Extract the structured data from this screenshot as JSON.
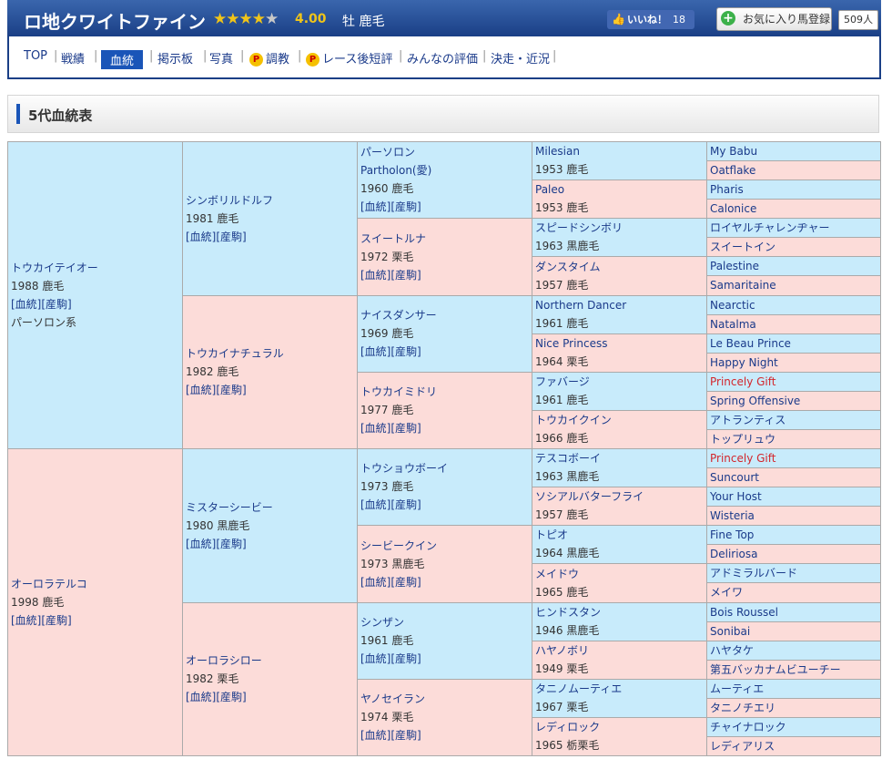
{
  "header": {
    "horse_name": "ロ地クワイトファイン",
    "rating_stars_filled": 4,
    "rating_stars_total": 5,
    "rating_value": "4.00",
    "sex_color": "牡 鹿毛",
    "like_label": "いいね！",
    "like_count": "18",
    "fav_label": "お気に入り馬登録",
    "fav_count": "509人"
  },
  "nav": {
    "items": [
      "TOP",
      "戦績",
      "血統",
      "掲示板",
      "写真",
      "調教",
      "レース後短評",
      "みんなの評価",
      "決走・近況"
    ],
    "active": "血統"
  },
  "section": {
    "title": "5代血統表"
  },
  "links": {
    "pedigree": "[血統]",
    "offspring": "[産駒]"
  },
  "pedigree": {
    "g1": [
      {
        "name": "トウカイテイオー",
        "info": "1988 鹿毛",
        "extra": "パーソロン系"
      },
      {
        "name": "オーロラテルコ",
        "info": "1998 鹿毛"
      }
    ],
    "g2": [
      {
        "name": "シンボリルドルフ",
        "info": "1981 鹿毛"
      },
      {
        "name": "トウカイナチュラル",
        "info": "1982 鹿毛"
      },
      {
        "name": "ミスターシービー",
        "info": "1980 黒鹿毛"
      },
      {
        "name": "オーロラシロー",
        "info": "1982 栗毛"
      }
    ],
    "g3": [
      {
        "name": "パーソロン",
        "sub": "Partholon(愛)",
        "info": "1960 鹿毛"
      },
      {
        "name": "スイートルナ",
        "info": "1972 栗毛"
      },
      {
        "name": "ナイスダンサー",
        "info": "1969 鹿毛"
      },
      {
        "name": "トウカイミドリ",
        "info": "1977 鹿毛"
      },
      {
        "name": "トウショウボーイ",
        "info": "1973 鹿毛"
      },
      {
        "name": "シービークイン",
        "info": "1973 黒鹿毛"
      },
      {
        "name": "シンザン",
        "info": "1961 鹿毛"
      },
      {
        "name": "ヤノセイラン",
        "info": "1974 栗毛"
      }
    ],
    "g4": [
      {
        "name": "Milesian",
        "info": "1953 鹿毛"
      },
      {
        "name": "Paleo",
        "info": "1953 鹿毛"
      },
      {
        "name": "スピードシンボリ",
        "info": "1963 黒鹿毛"
      },
      {
        "name": "ダンスタイム",
        "info": "1957 鹿毛"
      },
      {
        "name": "Northern Dancer",
        "info": "1961 鹿毛"
      },
      {
        "name": "Nice Princess",
        "info": "1964 栗毛"
      },
      {
        "name": "ファバージ",
        "info": "1961 鹿毛"
      },
      {
        "name": "トウカイクイン",
        "info": "1966 鹿毛"
      },
      {
        "name": "テスコボーイ",
        "info": "1963 黒鹿毛"
      },
      {
        "name": "ソシアルバターフライ",
        "info": "1957 鹿毛"
      },
      {
        "name": "トピオ",
        "info": "1964 黒鹿毛"
      },
      {
        "name": "メイドウ",
        "info": "1965 鹿毛"
      },
      {
        "name": "ヒンドスタン",
        "info": "1946 黒鹿毛"
      },
      {
        "name": "ハヤノボリ",
        "info": "1949 栗毛"
      },
      {
        "name": "タニノムーティエ",
        "info": "1967 栗毛"
      },
      {
        "name": "レディロック",
        "info": "1965 栃栗毛"
      }
    ],
    "g5": [
      {
        "name": "My Babu"
      },
      {
        "name": "Oatflake"
      },
      {
        "name": "Pharis"
      },
      {
        "name": "Calonice"
      },
      {
        "name": "ロイヤルチャレンヂャー"
      },
      {
        "name": "スイートイン"
      },
      {
        "name": "Palestine"
      },
      {
        "name": "Samaritaine"
      },
      {
        "name": "Nearctic"
      },
      {
        "name": "Natalma"
      },
      {
        "name": "Le Beau Prince"
      },
      {
        "name": "Happy Night"
      },
      {
        "name": "Princely Gift",
        "highlight": true
      },
      {
        "name": "Spring Offensive"
      },
      {
        "name": "アトランティス"
      },
      {
        "name": "トップリュウ"
      },
      {
        "name": "Princely Gift",
        "highlight": true
      },
      {
        "name": "Suncourt"
      },
      {
        "name": "Your Host"
      },
      {
        "name": "Wisteria"
      },
      {
        "name": "Fine Top"
      },
      {
        "name": "Deliriosa"
      },
      {
        "name": "アドミラルバード"
      },
      {
        "name": "メイワ"
      },
      {
        "name": "Bois Roussel"
      },
      {
        "name": "Sonibai"
      },
      {
        "name": "ハヤタケ"
      },
      {
        "name": "第五バッカナムビユーチー"
      },
      {
        "name": "ムーティエ"
      },
      {
        "name": "タニノチエリ"
      },
      {
        "name": "チャイナロック"
      },
      {
        "name": "レディアリス"
      }
    ]
  },
  "colors": {
    "male_bg": "#c8ebfb",
    "female_bg": "#fcdcd9",
    "link": "#1a3a8a",
    "highlight": "#d3262c",
    "header_bg": "#1a3f86",
    "star": "#f0c419"
  }
}
